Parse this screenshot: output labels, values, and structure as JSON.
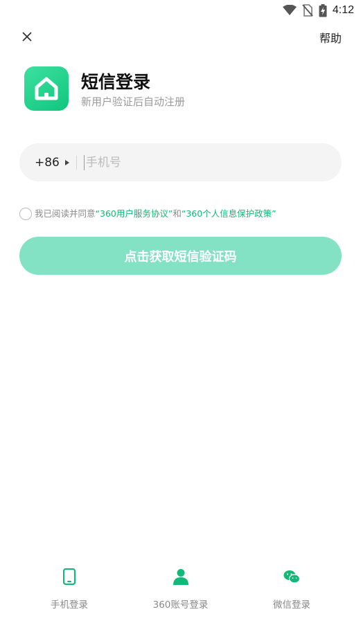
{
  "status_bar": {
    "time": "4:12",
    "icons": [
      "wifi-icon",
      "no-sim-icon",
      "battery-charging-icon"
    ]
  },
  "topbar": {
    "close_icon": "close-icon",
    "help_label": "帮助"
  },
  "header": {
    "logo_icon": "house-icon",
    "title": "短信登录",
    "subtitle": "新用户验证后自动注册"
  },
  "phone": {
    "country_code": "+86",
    "placeholder": "手机号",
    "value": ""
  },
  "agreement": {
    "prefix": "我已阅读并同意 ",
    "link1": "“360用户服务协议”",
    "joiner": "和",
    "link2": "“360个人信息保护政策”"
  },
  "get_code_label": "点击获取短信验证码",
  "login_options": [
    {
      "icon": "phone-icon",
      "label": "手机登录"
    },
    {
      "icon": "user-icon",
      "label": "360账号登录"
    },
    {
      "icon": "wechat-icon",
      "label": "微信登录"
    }
  ],
  "colors": {
    "accent": "#12b877",
    "button_disabled": "#84e2c4",
    "logo_gradient_start": "#3de0a0",
    "logo_gradient_end": "#10c67e"
  }
}
